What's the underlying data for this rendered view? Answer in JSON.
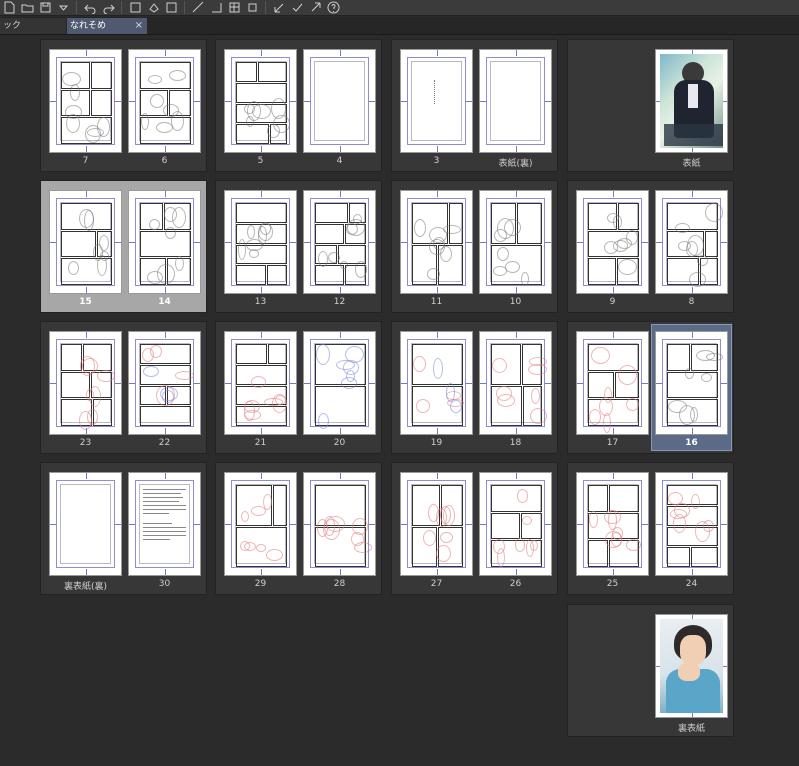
{
  "toolbar": {
    "icons": [
      "new-page-icon",
      "open-folder-icon",
      "save-icon",
      "dropdown-arrow-icon",
      "undo-icon",
      "redo-icon",
      "transform-icon",
      "fill-icon",
      "select-icon",
      "ruler-icon",
      "snap-icon",
      "grid-icon",
      "square-icon",
      "arrow-in-icon",
      "check-icon",
      "arrow-out-icon",
      "help-icon"
    ]
  },
  "tabs": [
    {
      "label": "ック",
      "active": false
    },
    {
      "label": "なれそめ",
      "active": true,
      "close": "×"
    }
  ],
  "spreads": [
    {
      "row": 0,
      "col": 0,
      "pages": [
        {
          "label": "7",
          "style": "gray"
        },
        {
          "label": "6",
          "style": "gray"
        }
      ]
    },
    {
      "row": 0,
      "col": 1,
      "pages": [
        {
          "label": "5",
          "style": "gray-light"
        },
        {
          "label": "4",
          "style": "blank"
        }
      ]
    },
    {
      "row": 0,
      "col": 2,
      "pages": [
        {
          "label": "3",
          "style": "text"
        },
        {
          "label": "表紙(裏)",
          "style": "blank"
        }
      ]
    },
    {
      "row": 0,
      "col": 3,
      "pages": [
        {
          "label": "表紙",
          "style": "cover"
        }
      ]
    },
    {
      "row": 1,
      "col": 0,
      "selected": true,
      "pages": [
        {
          "label": "15",
          "style": "gray",
          "bold": true
        },
        {
          "label": "14",
          "style": "gray",
          "bold": true
        }
      ]
    },
    {
      "row": 1,
      "col": 1,
      "pages": [
        {
          "label": "13",
          "style": "gray"
        },
        {
          "label": "12",
          "style": "gray"
        }
      ]
    },
    {
      "row": 1,
      "col": 2,
      "pages": [
        {
          "label": "11",
          "style": "gray"
        },
        {
          "label": "10",
          "style": "gray"
        }
      ]
    },
    {
      "row": 1,
      "col": 3,
      "pages": [
        {
          "label": "9",
          "style": "gray"
        },
        {
          "label": "8",
          "style": "gray"
        }
      ]
    },
    {
      "row": 2,
      "col": 0,
      "pages": [
        {
          "label": "23",
          "style": "red"
        },
        {
          "label": "22",
          "style": "red-blue"
        }
      ]
    },
    {
      "row": 2,
      "col": 1,
      "pages": [
        {
          "label": "21",
          "style": "red"
        },
        {
          "label": "20",
          "style": "blue"
        }
      ]
    },
    {
      "row": 2,
      "col": 2,
      "pages": [
        {
          "label": "19",
          "style": "red-blue"
        },
        {
          "label": "18",
          "style": "red"
        }
      ]
    },
    {
      "row": 2,
      "col": 3,
      "pages": [
        {
          "label": "17",
          "style": "red"
        },
        {
          "label": "16",
          "style": "gray",
          "bold": true,
          "highlight": true
        }
      ]
    },
    {
      "row": 3,
      "col": 0,
      "pages": [
        {
          "label": "裏表紙(裏)",
          "style": "blank"
        },
        {
          "label": "30",
          "style": "text-block"
        }
      ]
    },
    {
      "row": 3,
      "col": 1,
      "pages": [
        {
          "label": "29",
          "style": "red"
        },
        {
          "label": "28",
          "style": "red"
        }
      ]
    },
    {
      "row": 3,
      "col": 2,
      "pages": [
        {
          "label": "27",
          "style": "red"
        },
        {
          "label": "26",
          "style": "red"
        }
      ]
    },
    {
      "row": 3,
      "col": 3,
      "pages": [
        {
          "label": "25",
          "style": "red"
        },
        {
          "label": "24",
          "style": "red"
        }
      ]
    },
    {
      "row": 4,
      "col": 3,
      "pages": [
        {
          "label": "裏表紙",
          "style": "back-cover"
        }
      ]
    }
  ]
}
